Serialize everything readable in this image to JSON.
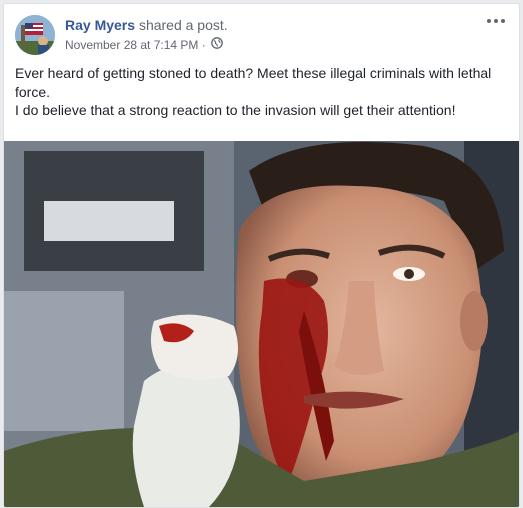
{
  "post": {
    "author": "Ray Myers",
    "action": "shared a post.",
    "timestamp": "November 28 at 7:14 PM",
    "separator": "·",
    "privacy_icon": "globe-icon",
    "more_icon": "more-options-icon",
    "text_lines": [
      "Ever heard of getting stoned to death? Meet these illegal criminals with lethal force.",
      "I do believe that a strong reaction to the invasion will get their attention!"
    ]
  },
  "colors": {
    "link": "#365899",
    "text": "#1d2129",
    "meta": "#616770",
    "background": "#e9ebee"
  }
}
